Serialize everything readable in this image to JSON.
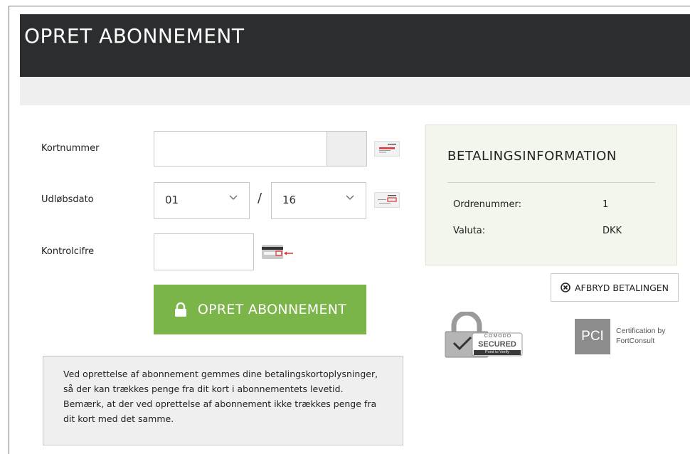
{
  "header": {
    "title": "OPRET ABONNEMENT"
  },
  "form": {
    "card_number_label": "Kortnummer",
    "card_number_value": "",
    "expiry_label": "Udløbsdato",
    "expiry_month": "01",
    "expiry_separator": "/",
    "expiry_year": "16",
    "cvc_label": "Kontrolcifre",
    "cvc_value": "",
    "submit_label": "OPRET ABONNEMENT",
    "notice": "Ved oprettelse af abonnement gemmes dine betalingskortoplysninger, så der kan trækkes penge fra dit kort i abonnementets levetid. Bemærk, at der ved oprettelse af abonnement ikke trækkes penge fra dit kort med det samme."
  },
  "payment_info": {
    "title": "BETALINGSINFORMATION",
    "order_label": "Ordrenummer:",
    "order_value": "1",
    "currency_label": "Valuta:",
    "currency_value": "DKK"
  },
  "cancel_label": "AFBRYD BETALINGEN",
  "badges": {
    "comodo_top": "COMODO",
    "comodo_main": "SECURED",
    "comodo_sub": "Point to Verify",
    "pci_logo": "PCI",
    "pci_line1": "Certification by",
    "pci_line2": "FortConsult"
  },
  "colors": {
    "header_bg": "#2b2d2e",
    "accent_green": "#7bb449",
    "info_bg": "#f2f6ec"
  }
}
